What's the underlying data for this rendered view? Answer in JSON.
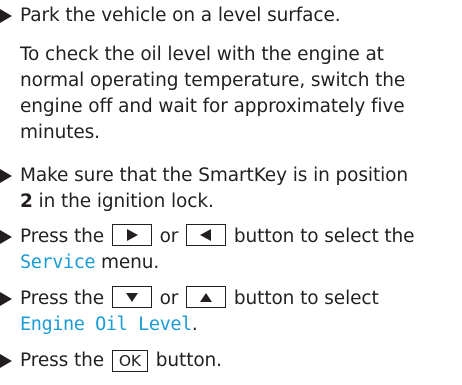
{
  "steps": [
    {
      "text": "Park the vehicle on a level surface."
    },
    {
      "note_lines": [
        "To check the oil level with the engine at",
        "normal operating temperature, switch the",
        "engine off and wait for approximately five",
        "minutes."
      ]
    },
    {
      "line1": "Make sure that the SmartKey is in position",
      "bold": "2",
      "line2_rest": " in the ignition lock."
    },
    {
      "pre": "Press the",
      "btn_right_icon": "triangle-right",
      "mid": "or",
      "btn_left_icon": "triangle-left",
      "post": "button to select the",
      "menu": "Service",
      "menu_suffix": " menu."
    },
    {
      "pre": "Press the",
      "btn_down_icon": "triangle-down",
      "mid": "or",
      "btn_up_icon": "triangle-up",
      "post": "button to select",
      "menu": "Engine Oil Level",
      "menu_suffix": "."
    },
    {
      "pre": "Press the",
      "ok_label": "OK",
      "post": "button."
    }
  ],
  "colors": {
    "text": "#231f20",
    "display_text": "#1a9cd6"
  }
}
